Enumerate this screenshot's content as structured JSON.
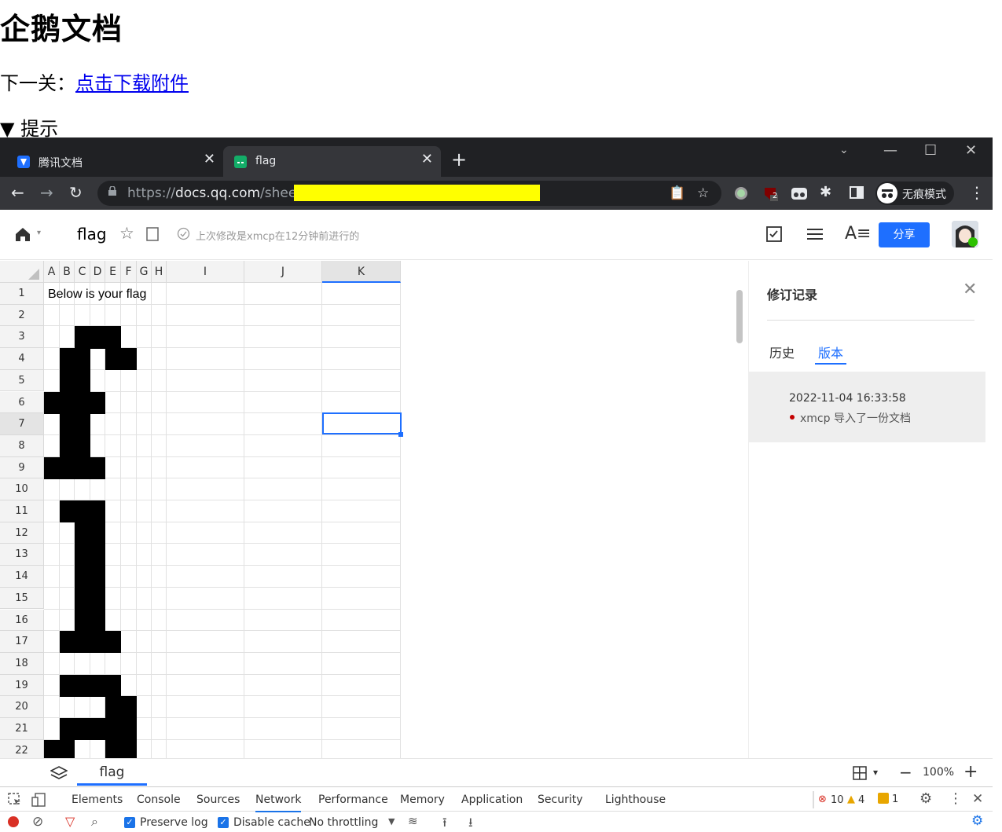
{
  "page": {
    "title": "企鹅文档",
    "next_prefix": "下一关：",
    "next_link": "点击下载附件",
    "hint": "▼ 提示"
  },
  "browser": {
    "tabs": [
      {
        "label": "腾讯文档",
        "active": false
      },
      {
        "label": "flag",
        "active": true
      }
    ],
    "url_prefix": "https://",
    "url_domain": "docs.qq.com",
    "url_path": "/sheet/",
    "incognito_label": "无痕模式",
    "ext_badge": "2"
  },
  "doc": {
    "title": "flag",
    "save_status": "上次修改是xmcp在12分钟前进行的",
    "share_label": "分享"
  },
  "sheet": {
    "columns": [
      "A",
      "B",
      "C",
      "D",
      "E",
      "F",
      "G",
      "H",
      "I",
      "J",
      "K"
    ],
    "rows": [
      "1",
      "2",
      "3",
      "4",
      "5",
      "6",
      "7",
      "8",
      "9",
      "10",
      "11",
      "12",
      "13",
      "14",
      "15",
      "16",
      "17",
      "18",
      "19",
      "20",
      "21",
      "22"
    ],
    "cell_A1": "Below is your flag",
    "selected_cell": "K7",
    "tab_name": "flag",
    "zoom": "100%"
  },
  "revision_panel": {
    "title": "修订记录",
    "tabs": [
      "历史",
      "版本"
    ],
    "active_tab": "版本",
    "entries": [
      {
        "date": "2022-11-04 16:33:58",
        "user": "xmcp",
        "action": "导入了一份文档"
      }
    ]
  },
  "devtools": {
    "tabs": [
      "Elements",
      "Console",
      "Sources",
      "Network",
      "Performance",
      "Memory",
      "Application",
      "Security",
      "Lighthouse"
    ],
    "active_tab": "Network",
    "errors": "10",
    "warnings": "4",
    "issues": "1",
    "preserve_log": "Preserve log",
    "disable_cache": "Disable cache",
    "throttling": "No throttling"
  },
  "colors": {
    "accent": "#1e6fff",
    "chrome_dark": "#202124",
    "chrome_mid": "#35363a",
    "url_highlight": "#ffff00"
  }
}
